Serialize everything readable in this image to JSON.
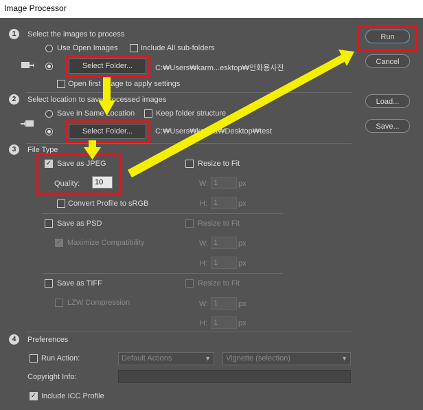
{
  "window": {
    "title": "Image Processor"
  },
  "section1": {
    "num": "1",
    "title": "Select the images to process",
    "use_open_images": "Use Open Images",
    "include_subfolders": "Include All sub-folders",
    "select_folder": "Select Folder...",
    "folder_path": "C:₩Users₩karm...esktop₩인화용사진",
    "open_first": "Open first image to apply settings"
  },
  "section2": {
    "num": "2",
    "title": "Select location to save processed images",
    "save_same": "Save in Same Location",
    "keep_structure": "Keep folder structure",
    "select_folder": "Select Folder...",
    "folder_path": "C:₩Users₩karma₩Desktop₩test"
  },
  "section3": {
    "num": "3",
    "title": "File Type",
    "jpeg": {
      "label": "Save as JPEG",
      "quality_label": "Quality:",
      "quality_value": "10",
      "resize": "Resize to Fit",
      "w_label": "W:",
      "w_value": "1",
      "h_label": "H:",
      "h_value": "1",
      "unit": "px",
      "convert_profile": "Convert Profile to sRGB"
    },
    "psd": {
      "label": "Save as PSD",
      "resize": "Resize to Fit",
      "maximize": "Maximize Compatibility",
      "w_label": "W:",
      "w_value": "1",
      "h_label": "H:",
      "h_value": "1",
      "unit": "px"
    },
    "tiff": {
      "label": "Save as TIFF",
      "resize": "Resize to Fit",
      "lzw": "LZW Compression",
      "w_label": "W:",
      "w_value": "1",
      "h_label": "H:",
      "h_value": "1",
      "unit": "px"
    }
  },
  "section4": {
    "num": "4",
    "title": "Preferences",
    "run_action": "Run Action:",
    "action_set": "Default Actions",
    "action": "Vignette (selection)",
    "copyright_label": "Copyright Info:",
    "copyright_value": "",
    "include_icc": "Include ICC Profile"
  },
  "buttons": {
    "run": "Run",
    "cancel": "Cancel",
    "load": "Load...",
    "save": "Save..."
  },
  "colors": {
    "annotation_red": "#e8141b",
    "annotation_yellow": "#f5f000",
    "panel": "#535353"
  }
}
